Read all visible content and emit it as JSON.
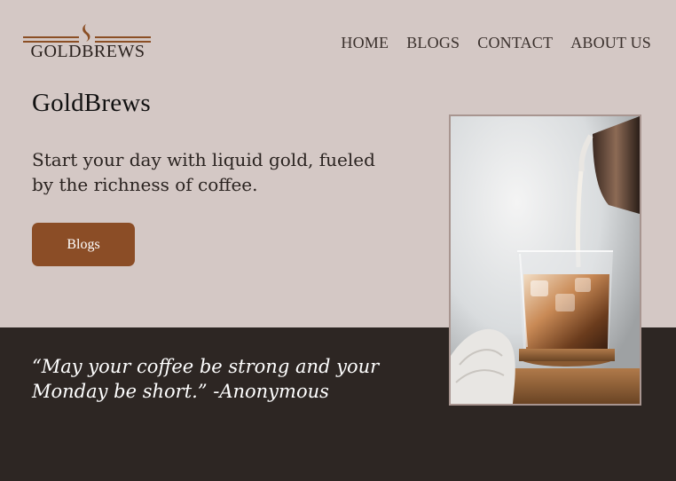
{
  "header": {
    "logo_text": "GOLDBREWS",
    "nav": [
      {
        "label": "HOME"
      },
      {
        "label": "BLOGS"
      },
      {
        "label": "CONTACT"
      },
      {
        "label": "ABOUT US"
      }
    ]
  },
  "hero": {
    "title": "GoldBrews",
    "tagline": "Start your day with liquid gold, fueled by the richness of coffee.",
    "button_label": "Blogs"
  },
  "quote": {
    "text": "“May your coffee be strong and your Monday be short.” -Anonymous"
  },
  "colors": {
    "background": "#d4c8c5",
    "dark_band": "#2d2623",
    "accent": "#8b4d26"
  },
  "photo": {
    "subject": "iced-coffee-with-milk-pour"
  }
}
